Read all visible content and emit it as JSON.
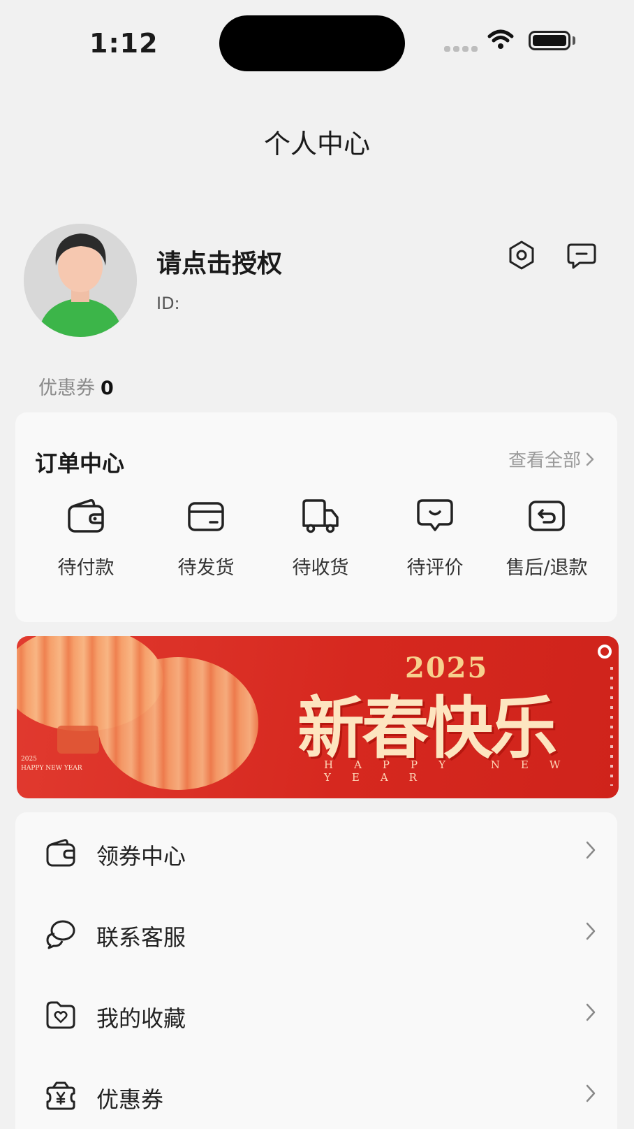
{
  "status_bar": {
    "time": "1:12"
  },
  "header": {
    "title": "个人中心"
  },
  "profile": {
    "username": "请点击授权",
    "id_label": "ID:",
    "id_value": "",
    "coupon_label": "优惠券",
    "coupon_count": "0",
    "icons": [
      "settings-hexagon-icon",
      "message-icon"
    ]
  },
  "orders": {
    "title": "订单中心",
    "view_all": "查看全部",
    "items": [
      {
        "label": "待付款",
        "icon": "wallet-icon"
      },
      {
        "label": "待发货",
        "icon": "card-icon"
      },
      {
        "label": "待收货",
        "icon": "truck-icon"
      },
      {
        "label": "待评价",
        "icon": "comment-icon"
      },
      {
        "label": "售后/退款",
        "icon": "return-icon"
      }
    ]
  },
  "banner": {
    "year": "2025",
    "greeting": "新春快乐",
    "subtitle": "HAPPY NEW YEAR",
    "small_year": "2025",
    "small_subtitle": "HAPPY NEW YEAR",
    "colors": {
      "background": "#d92b21",
      "greeting": "#fde5c0",
      "year": "#f7d18e"
    }
  },
  "menu": [
    {
      "label": "领券中心",
      "icon": "coupon-wallet-icon"
    },
    {
      "label": "联系客服",
      "icon": "chat-bubbles-icon"
    },
    {
      "label": "我的收藏",
      "icon": "favorite-folder-icon"
    },
    {
      "label": "优惠券",
      "icon": "coupon-yen-icon"
    }
  ]
}
